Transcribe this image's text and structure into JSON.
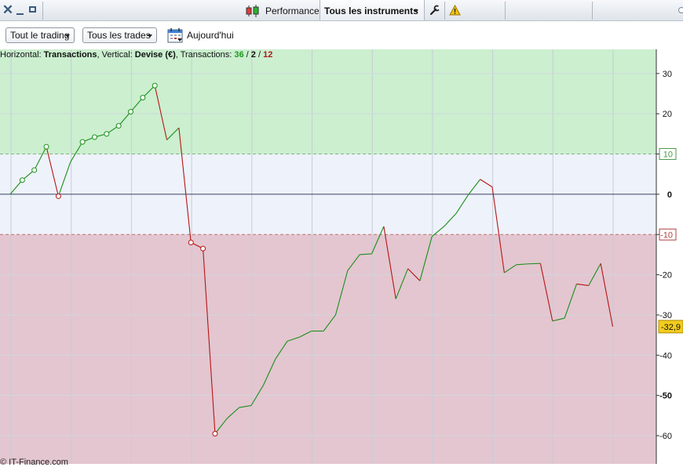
{
  "toolbar": {
    "title": "Performance",
    "instrument_label": "Tous les instruments",
    "icons": {
      "close": "close-icon",
      "minimize": "minimize-icon",
      "maximize": "maximize-icon",
      "performance": "candlestick-icon",
      "settings": "wrench-icon",
      "warning": "warning-icon"
    }
  },
  "filters": {
    "trading_label": "Tout le trading",
    "trades_label": "Tous les trades",
    "date_label": "Aujourd'hui"
  },
  "info": {
    "h_prefix": "Horizontal: ",
    "h_value": "Transactions",
    "v_prefix": ", Vertical: ",
    "v_value": "Devise (€)",
    "t_prefix": ", Transactions: ",
    "total": "36",
    "sep1": " / ",
    "neutral": "2",
    "sep2": " / ",
    "losses": "12"
  },
  "footer": "© IT-Finance.com",
  "colors": {
    "profit_zone": "#cbefcf",
    "neutral_zone": "#eef2fb",
    "loss_zone": "#e3c6d0",
    "up_line": "#1a8f1a",
    "down_line": "#b81414",
    "last_badge": "#f3cc1e"
  },
  "chart_data": {
    "type": "line",
    "xlabel": "Transactions",
    "ylabel": "Devise (€)",
    "ylim": [
      -67,
      36
    ],
    "y_ticks": [
      30,
      20,
      10,
      0,
      -10,
      -20,
      -30,
      -40,
      -50,
      -60
    ],
    "bold_ticks": [
      0,
      -50
    ],
    "threshold_high": 10,
    "threshold_low": -10,
    "last_value_label": "-32,9",
    "values": [
      0,
      3.5,
      6,
      11.8,
      -0.5,
      8,
      13,
      14.2,
      15,
      17,
      20.5,
      24,
      27,
      13.5,
      16.5,
      -12,
      -13.5,
      -59.5,
      -55.7,
      -53,
      -52.5,
      -47.5,
      -41,
      -36.5,
      -35.5,
      -34,
      -34,
      -30,
      -19,
      -15,
      -14.8,
      -8,
      -26,
      -18.5,
      -21.5,
      -10.5,
      -8,
      -4.8,
      -0.2,
      3.7,
      1.8,
      -19.5,
      -17.5,
      -17.3,
      -17.2,
      -31.5,
      -30.8,
      -22.3,
      -22.7,
      -17.2,
      -32.9
    ],
    "markers": [
      1,
      2,
      3,
      4,
      6,
      7,
      8,
      9,
      10,
      11,
      12,
      15,
      16,
      17
    ]
  }
}
